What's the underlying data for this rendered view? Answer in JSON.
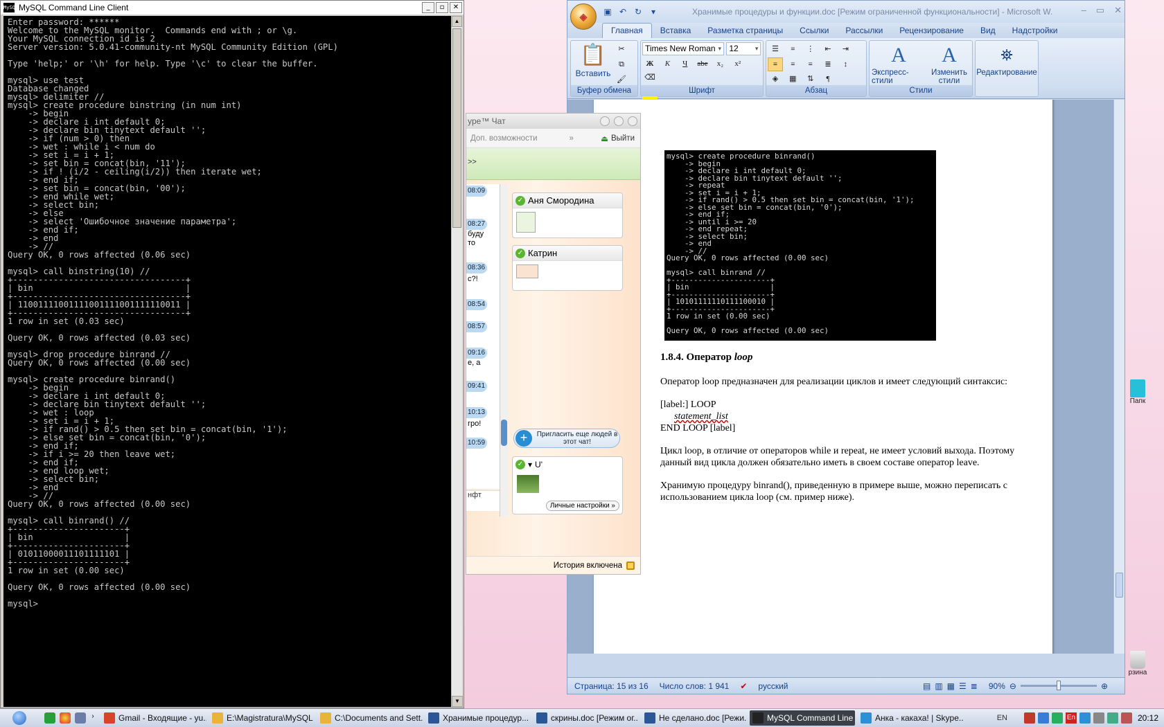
{
  "console": {
    "title": "MySQL Command Line Client",
    "icon_label": "MySQL",
    "lines": [
      "Enter password: ******",
      "Welcome to the MySQL monitor.  Commands end with ; or \\g.",
      "Your MySQL connection id is 2",
      "Server version: 5.0.41-community-nt MySQL Community Edition (GPL)",
      "",
      "Type 'help;' or '\\h' for help. Type '\\c' to clear the buffer.",
      "",
      "mysql> use test",
      "Database changed",
      "mysql> delimiter //",
      "mysql> create procedure binstring (in num int)",
      "    -> begin",
      "    -> declare i int default 0;",
      "    -> declare bin tinytext default '';",
      "    -> if (num > 0) then",
      "    -> wet : while i < num do",
      "    -> set i = i + 1;",
      "    -> set bin = concat(bin, '11');",
      "    -> if ! (i/2 - ceiling(i/2)) then iterate wet;",
      "    -> end if;",
      "    -> set bin = concat(bin, '00');",
      "    -> end while wet;",
      "    -> select bin;",
      "    -> else",
      "    -> select 'Ошибочное значение параметра';",
      "    -> end if;",
      "    -> end",
      "    -> //",
      "Query OK, 0 rows affected (0.06 sec)",
      "",
      "mysql> call binstring(10) //",
      "+----------------------------------+",
      "| bin                              |",
      "+----------------------------------+",
      "| 11001111001111001111001111110011 |",
      "+----------------------------------+",
      "1 row in set (0.03 sec)",
      "",
      "Query OK, 0 rows affected (0.03 sec)",
      "",
      "mysql> drop procedure binrand //",
      "Query OK, 0 rows affected (0.00 sec)",
      "",
      "mysql> create procedure binrand()",
      "    -> begin",
      "    -> declare i int default 0;",
      "    -> declare bin tinytext default '';",
      "    -> wet : loop",
      "    -> set i = i + 1;",
      "    -> if rand() > 0.5 then set bin = concat(bin, '1');",
      "    -> else set bin = concat(bin, '0');",
      "    -> end if;",
      "    -> if i >= 20 then leave wet;",
      "    -> end if;",
      "    -> end loop wet;",
      "    -> select bin;",
      "    -> end",
      "    -> //",
      "Query OK, 0 rows affected (0.00 sec)",
      "",
      "mysql> call binrand() //",
      "+----------------------+",
      "| bin                  |",
      "+----------------------+",
      "| 01011000011101111101 |",
      "+----------------------+",
      "1 row in set (0.00 sec)",
      "",
      "Query OK, 0 rows affected (0.00 sec)",
      "",
      "mysql>"
    ]
  },
  "word": {
    "title": "Хранимые процедуры и функции.doc [Режим ограниченной функциональности] - Microsoft W...",
    "tabs": [
      "Главная",
      "Вставка",
      "Разметка страницы",
      "Ссылки",
      "Рассылки",
      "Рецензирование",
      "Вид",
      "Надстройки"
    ],
    "groups": {
      "clipboard": "Буфер обмена",
      "font": "Шрифт",
      "paragraph": "Абзац",
      "styles": "Стили"
    },
    "paste_label": "Вставить",
    "font_name": "Times New Roman",
    "font_size": "12",
    "express_styles": "Экспресс-стили",
    "change_styles": "Изменить стили",
    "editing": "Редактирование",
    "embedded_console": [
      "mysql> create procedure binrand()",
      "    -> begin",
      "    -> declare i int default 0;",
      "    -> declare bin tinytext default '';",
      "    -> repeat",
      "    -> set i = i + 1;",
      "    -> if rand() > 0.5 then set bin = concat(bin, '1');",
      "    -> else set bin = concat(bin, '0');",
      "    -> end if;",
      "    -> until i >= 20",
      "    -> end repeat;",
      "    -> select bin;",
      "    -> end",
      "    -> //",
      "Query OK, 0 rows affected (0.00 sec)",
      "",
      "mysql> call binrand //",
      "+----------------------+",
      "| bin                  |",
      "+----------------------+",
      "| 10101111110111100010 |",
      "+----------------------+",
      "1 row in set (0.00 sec)",
      "",
      "Query OK, 0 rows affected (0.00 sec)"
    ],
    "heading_prefix": "1.8.4. Оператор ",
    "heading_italic": "loop",
    "para1": "Оператор loop предназначен для реализации циклов и имеет следующий синтаксис:",
    "syntax1": "[label:] LOOP",
    "syntax2": "statement_list",
    "syntax3": "END LOOP [label]",
    "para2_line1": "Цикл loop, в отличие от операторов while и repeat, не имеет условий выхода. Поэтому",
    "para2_line2": "данный вид цикла должен обязательно иметь в своем составе оператор leave.",
    "para3_line1": "Хранимую процедуру binrand(), приведенную в примере выше, можно переписать с",
    "para3_line2": "использованием цикла loop (см. пример ниже).",
    "status": {
      "page": "Страница: 15 из 16",
      "words": "Число слов: 1 941",
      "lang": "русский",
      "zoom": "90%"
    }
  },
  "skype": {
    "title": "ype™ Чат",
    "more_options": "Доп. возможности",
    "exit": "Выйти",
    "green_prompt": ">>",
    "timestamps": [
      "08:09",
      "08:27",
      "08:36",
      "08:54",
      "08:57",
      "09:16",
      "09:41",
      "10:13",
      "10:59"
    ],
    "msgs": [
      "буду",
      "то",
      "c?!",
      "е, а",
      "гро!"
    ],
    "input_text": "нфт",
    "contact1": "Аня Смородина",
    "contact2": "Катрин",
    "invite": "Пригласить еще людей в этот чат!",
    "self_name": "U'",
    "personal_settings": "Личные настройки »",
    "history": "История включена"
  },
  "desktop": {
    "icon1_label": "Папк",
    "icon2_label": "рзина"
  },
  "taskbar": {
    "tasks": [
      "Gmail - Входящие - yu...",
      "E:\\Magistratura\\MySQL",
      "C:\\Documents and Sett...",
      "Хранимые процедур...",
      "скрины.doc [Режим ог...",
      "Не сделано.doc [Режи...",
      "MySQL Command Line ...",
      "Анка - какаха! | Skype..."
    ],
    "active_index": 6,
    "lang_en": "EN",
    "lang_tray": "En",
    "clock": "20:12"
  },
  "colors": {
    "console_bg": "#000000",
    "word_accent": "#15428b",
    "skype_online": "#5cb531",
    "taskbar_active": "#3a3f48"
  }
}
